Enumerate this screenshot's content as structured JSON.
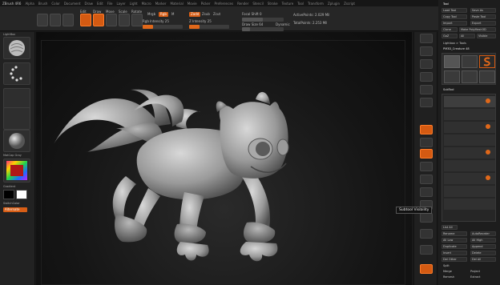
{
  "menu": {
    "brand": "ZBrush 4R6",
    "items": [
      "Alpha",
      "Brush",
      "Color",
      "Document",
      "Draw",
      "Edit",
      "File",
      "Layer",
      "Light",
      "Macro",
      "Marker",
      "Material",
      "Movie",
      "Picker",
      "Preferences",
      "Render",
      "Stencil",
      "Stroke",
      "Texture",
      "Tool",
      "Transform",
      "Zplugin",
      "Zscript"
    ]
  },
  "toolbar": {
    "edit": "Edit",
    "draw": "Draw",
    "move": "Move",
    "scale": "Scale",
    "rotate": "Rotate",
    "mrgb": "Mrgb",
    "rgb": "Rgb",
    "m": "M",
    "rgb_intensity": "Rgb Intensity 25",
    "zadd": "Zadd",
    "zsub": "Zsub",
    "zcut": "Zcut",
    "z_intensity": "Z Intensity 25",
    "focal_shift": "Focal Shift 0",
    "draw_size": "Draw Size 64",
    "dynamic": "Dynamic",
    "active_points": "ActivePoints: 2.029 Mil",
    "total_points": "TotalPoints: 2.253 Mil",
    "rgb_intensity_level": 0.25,
    "z_intensity_level": 0.25
  },
  "left": {
    "lightbox": "LightBox",
    "material": "MatCap Gray",
    "texture": "Texture Off",
    "gradient": "Gradient",
    "switch_color": "SwitchColor",
    "alternate": "Alternate"
  },
  "tooltip": "Subtool Visibility",
  "palette": {
    "tool": "Tool",
    "load_tool": "Load Tool",
    "save_as": "Save As",
    "copy_tool": "Copy Tool",
    "paste_tool": "Paste Tool",
    "import": "Import",
    "export": "Export",
    "clone": "Clone",
    "make_polymesh": "Make PolyMesh3D",
    "goz": "GoZ",
    "all": "All",
    "visible": "Visible",
    "lightbox_tools": "Lightbox > Tools",
    "tool_name": "PM3D_Creature 48",
    "subtool": "SubTool",
    "list_all": "List All",
    "rename": "Rename",
    "autoreorder": "AutoReorder",
    "all_low": "All Low",
    "all_high": "All High",
    "duplicate": "Duplicate",
    "append": "Append",
    "insert": "Insert",
    "delete": "Delete",
    "del_other": "Del Other",
    "del_all": "Del All",
    "split": "Split",
    "merge": "Merge",
    "remesh": "Remesh",
    "project": "Project",
    "extract": "Extract"
  }
}
